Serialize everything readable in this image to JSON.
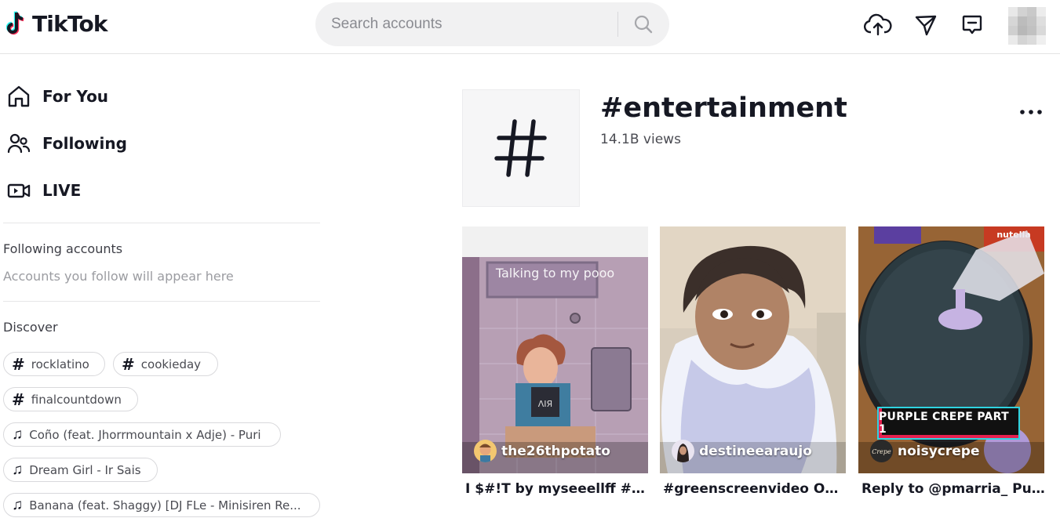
{
  "header": {
    "logo_text": "TikTok",
    "search_placeholder": "Search accounts",
    "icons": [
      "upload-icon",
      "send-icon",
      "inbox-icon"
    ],
    "accent_colors": {
      "cyan": "#25F4EE",
      "red": "#FE2C55"
    }
  },
  "sidebar": {
    "nav": [
      {
        "label": "For You",
        "icon": "home-icon"
      },
      {
        "label": "Following",
        "icon": "people-icon"
      },
      {
        "label": "LIVE",
        "icon": "live-camera-icon"
      }
    ],
    "following_heading": "Following accounts",
    "following_empty": "Accounts you follow will appear here",
    "discover_heading": "Discover",
    "discover": [
      {
        "type": "hashtag",
        "label": "rocklatino"
      },
      {
        "type": "hashtag",
        "label": "cookieday"
      },
      {
        "type": "hashtag",
        "label": "finalcountdown"
      },
      {
        "type": "music",
        "label": "Coño (feat. Jhorrmountain x Adje) - Puri"
      },
      {
        "type": "music",
        "label": "Dream Girl - Ir Sais"
      },
      {
        "type": "music",
        "label": "Banana (feat. Shaggy) [DJ FLe - Minisiren Re..."
      }
    ]
  },
  "main": {
    "hashtag_title": "#entertainment",
    "views": "14.1B views",
    "videos": [
      {
        "username": "the26thpotato",
        "caption": "I $#!T by myseeellff #a...",
        "overlay": "Talking to my pooo"
      },
      {
        "username": "destineearaujo",
        "caption": "#greenscreenvideo OH..."
      },
      {
        "username": "noisycrepe",
        "caption": "Reply to @pmarria_ Pur...",
        "overlay": "PURPLE CREPE PART 1",
        "bg_labels": [
          "nutella"
        ],
        "avatar_text": "Crepe"
      }
    ]
  }
}
